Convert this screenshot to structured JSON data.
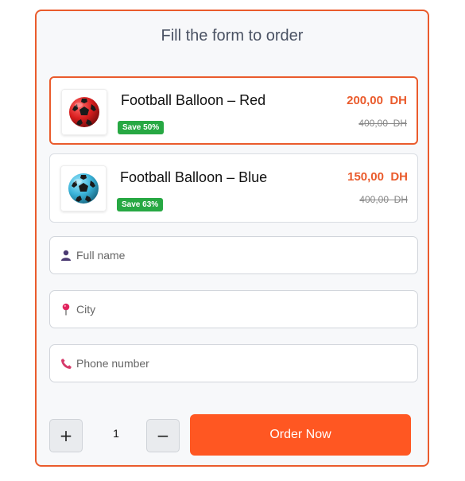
{
  "form": {
    "title": "Fill the form to order"
  },
  "products": [
    {
      "name": "Football Balloon – Red",
      "badge": "Save 50%",
      "price": "200,00  DH",
      "old_price": "400,00  DH",
      "ball_color": "#d81e1e",
      "selected": true
    },
    {
      "name": "Football Balloon – Blue",
      "badge": "Save 63%",
      "price": "150,00  DH",
      "old_price": "400,00  DH",
      "ball_color": "#3ab3d9",
      "selected": false
    }
  ],
  "fields": {
    "full_name": {
      "placeholder": "Full name",
      "icon": "user-icon"
    },
    "city": {
      "placeholder": "City",
      "icon": "location-pin-icon"
    },
    "phone": {
      "placeholder": "Phone number",
      "icon": "phone-icon"
    }
  },
  "quantity": {
    "plus_label": "+",
    "minus_label": "−",
    "value": "1"
  },
  "order_button": {
    "label": "Order Now"
  },
  "colors": {
    "accent": "#ea5b2c",
    "order_button": "#ff5722",
    "badge_green": "#27a843"
  }
}
